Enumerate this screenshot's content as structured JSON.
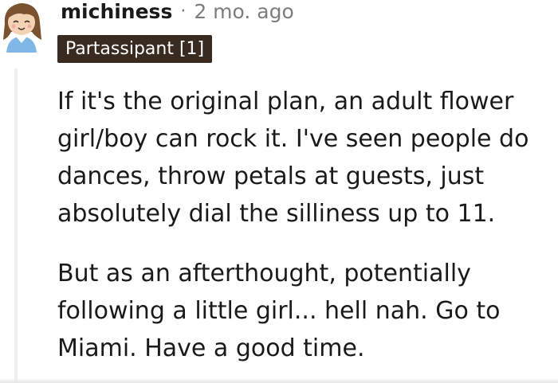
{
  "comment": {
    "author": "michiness",
    "separator": "·",
    "time_ago": "2 mo. ago",
    "flair": "Partassipant [1]",
    "avatar_icon": "cartoon-girl-avatar-icon",
    "paragraphs": [
      "If it's the original plan, an adult flower girl/boy can rock it. I've seen people do dances, throw petals at guests, just absolutely dial the silliness up to 11.",
      "But as an afterthought, potentially following a little girl... hell nah. Go to Miami. Have a good time."
    ]
  },
  "colors": {
    "text": "#1a1a1b",
    "meta": "#7c7c7c",
    "flair_bg": "#3a2b20",
    "flair_text": "#ffffff",
    "thread_line": "#edeff1"
  }
}
